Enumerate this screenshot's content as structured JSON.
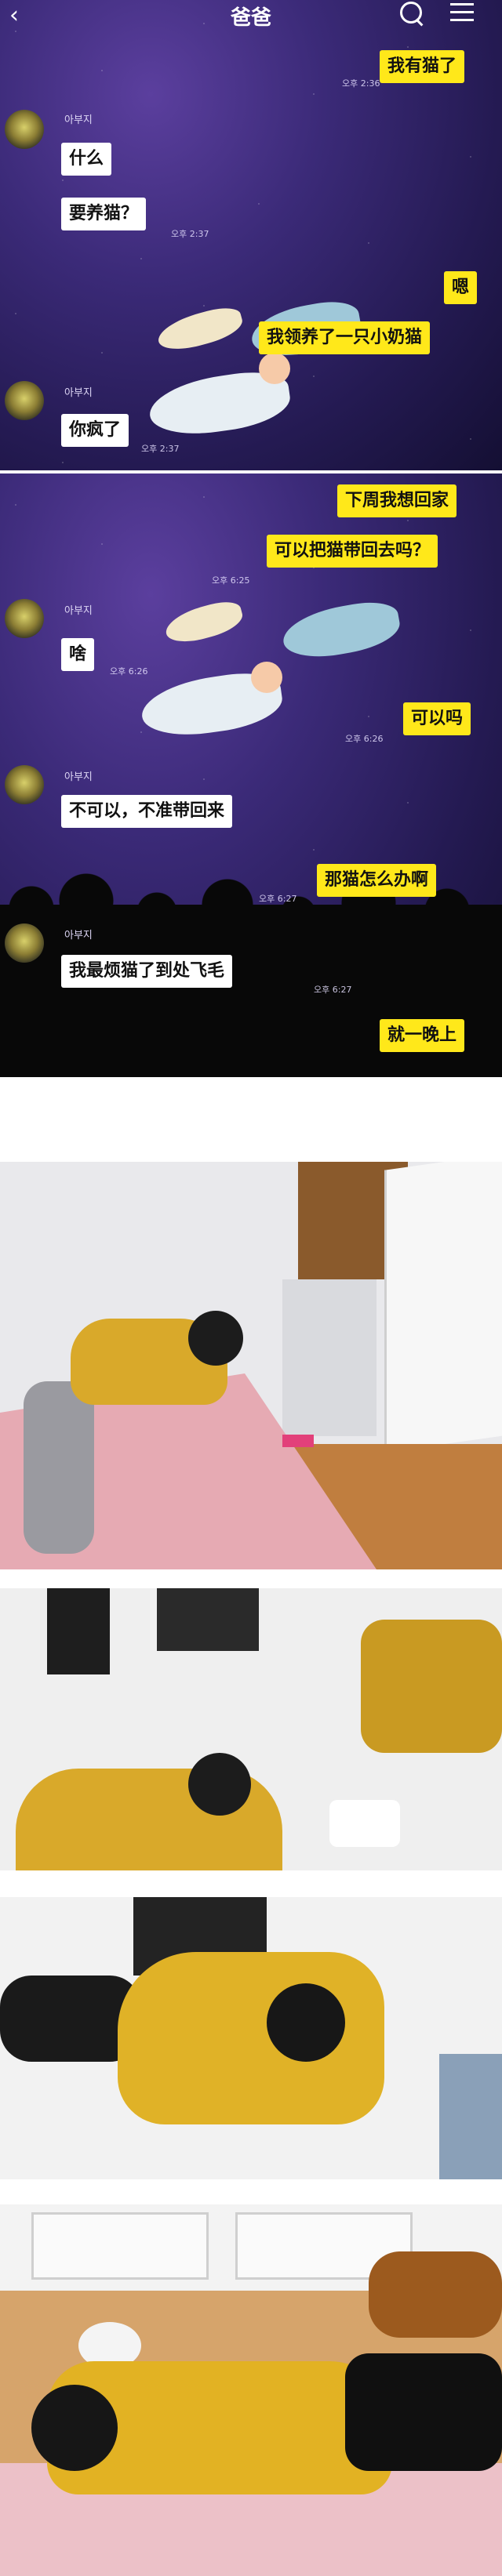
{
  "header": {
    "title": "爸爸",
    "back_icon": "chevron-left-icon",
    "search_icon": "search-icon",
    "menu_icon": "menu-icon"
  },
  "chat1": {
    "messages": [
      {
        "side": "right",
        "text": "我有猫了",
        "time": "오후 2:36"
      },
      {
        "side": "left",
        "sender": "아부지",
        "text": "什么"
      },
      {
        "side": "left",
        "text": "要养猫？",
        "time": "오후 2:37"
      },
      {
        "side": "right",
        "text": "嗯"
      },
      {
        "side": "right",
        "text": "我领养了一只小奶猫"
      },
      {
        "side": "left",
        "sender": "아부지",
        "text": "你疯了",
        "time": "오후 2:37"
      }
    ]
  },
  "chat2": {
    "messages": [
      {
        "side": "right",
        "text": "下周我想回家"
      },
      {
        "side": "right",
        "text": "可以把猫带回去吗？",
        "time": "오후 6:25"
      },
      {
        "side": "left",
        "sender": "아부지",
        "text": "啥",
        "time": "오후 6:26"
      },
      {
        "side": "right",
        "text": "可以吗",
        "time": "오후 6:26"
      },
      {
        "side": "left",
        "sender": "아부지",
        "text": "不可以，不准带回来"
      },
      {
        "side": "right",
        "text": "那猫怎么办啊",
        "time": "오후 6:27"
      },
      {
        "side": "left",
        "sender": "아부지",
        "text": "我最烦猫了到处飞毛",
        "time": "오후 6:27"
      },
      {
        "side": "right",
        "text": "就一晚上"
      }
    ]
  },
  "colors": {
    "bubble_yellow": "#ffe81a",
    "bubble_white": "#ffffff",
    "sky": "#3b2a78"
  }
}
